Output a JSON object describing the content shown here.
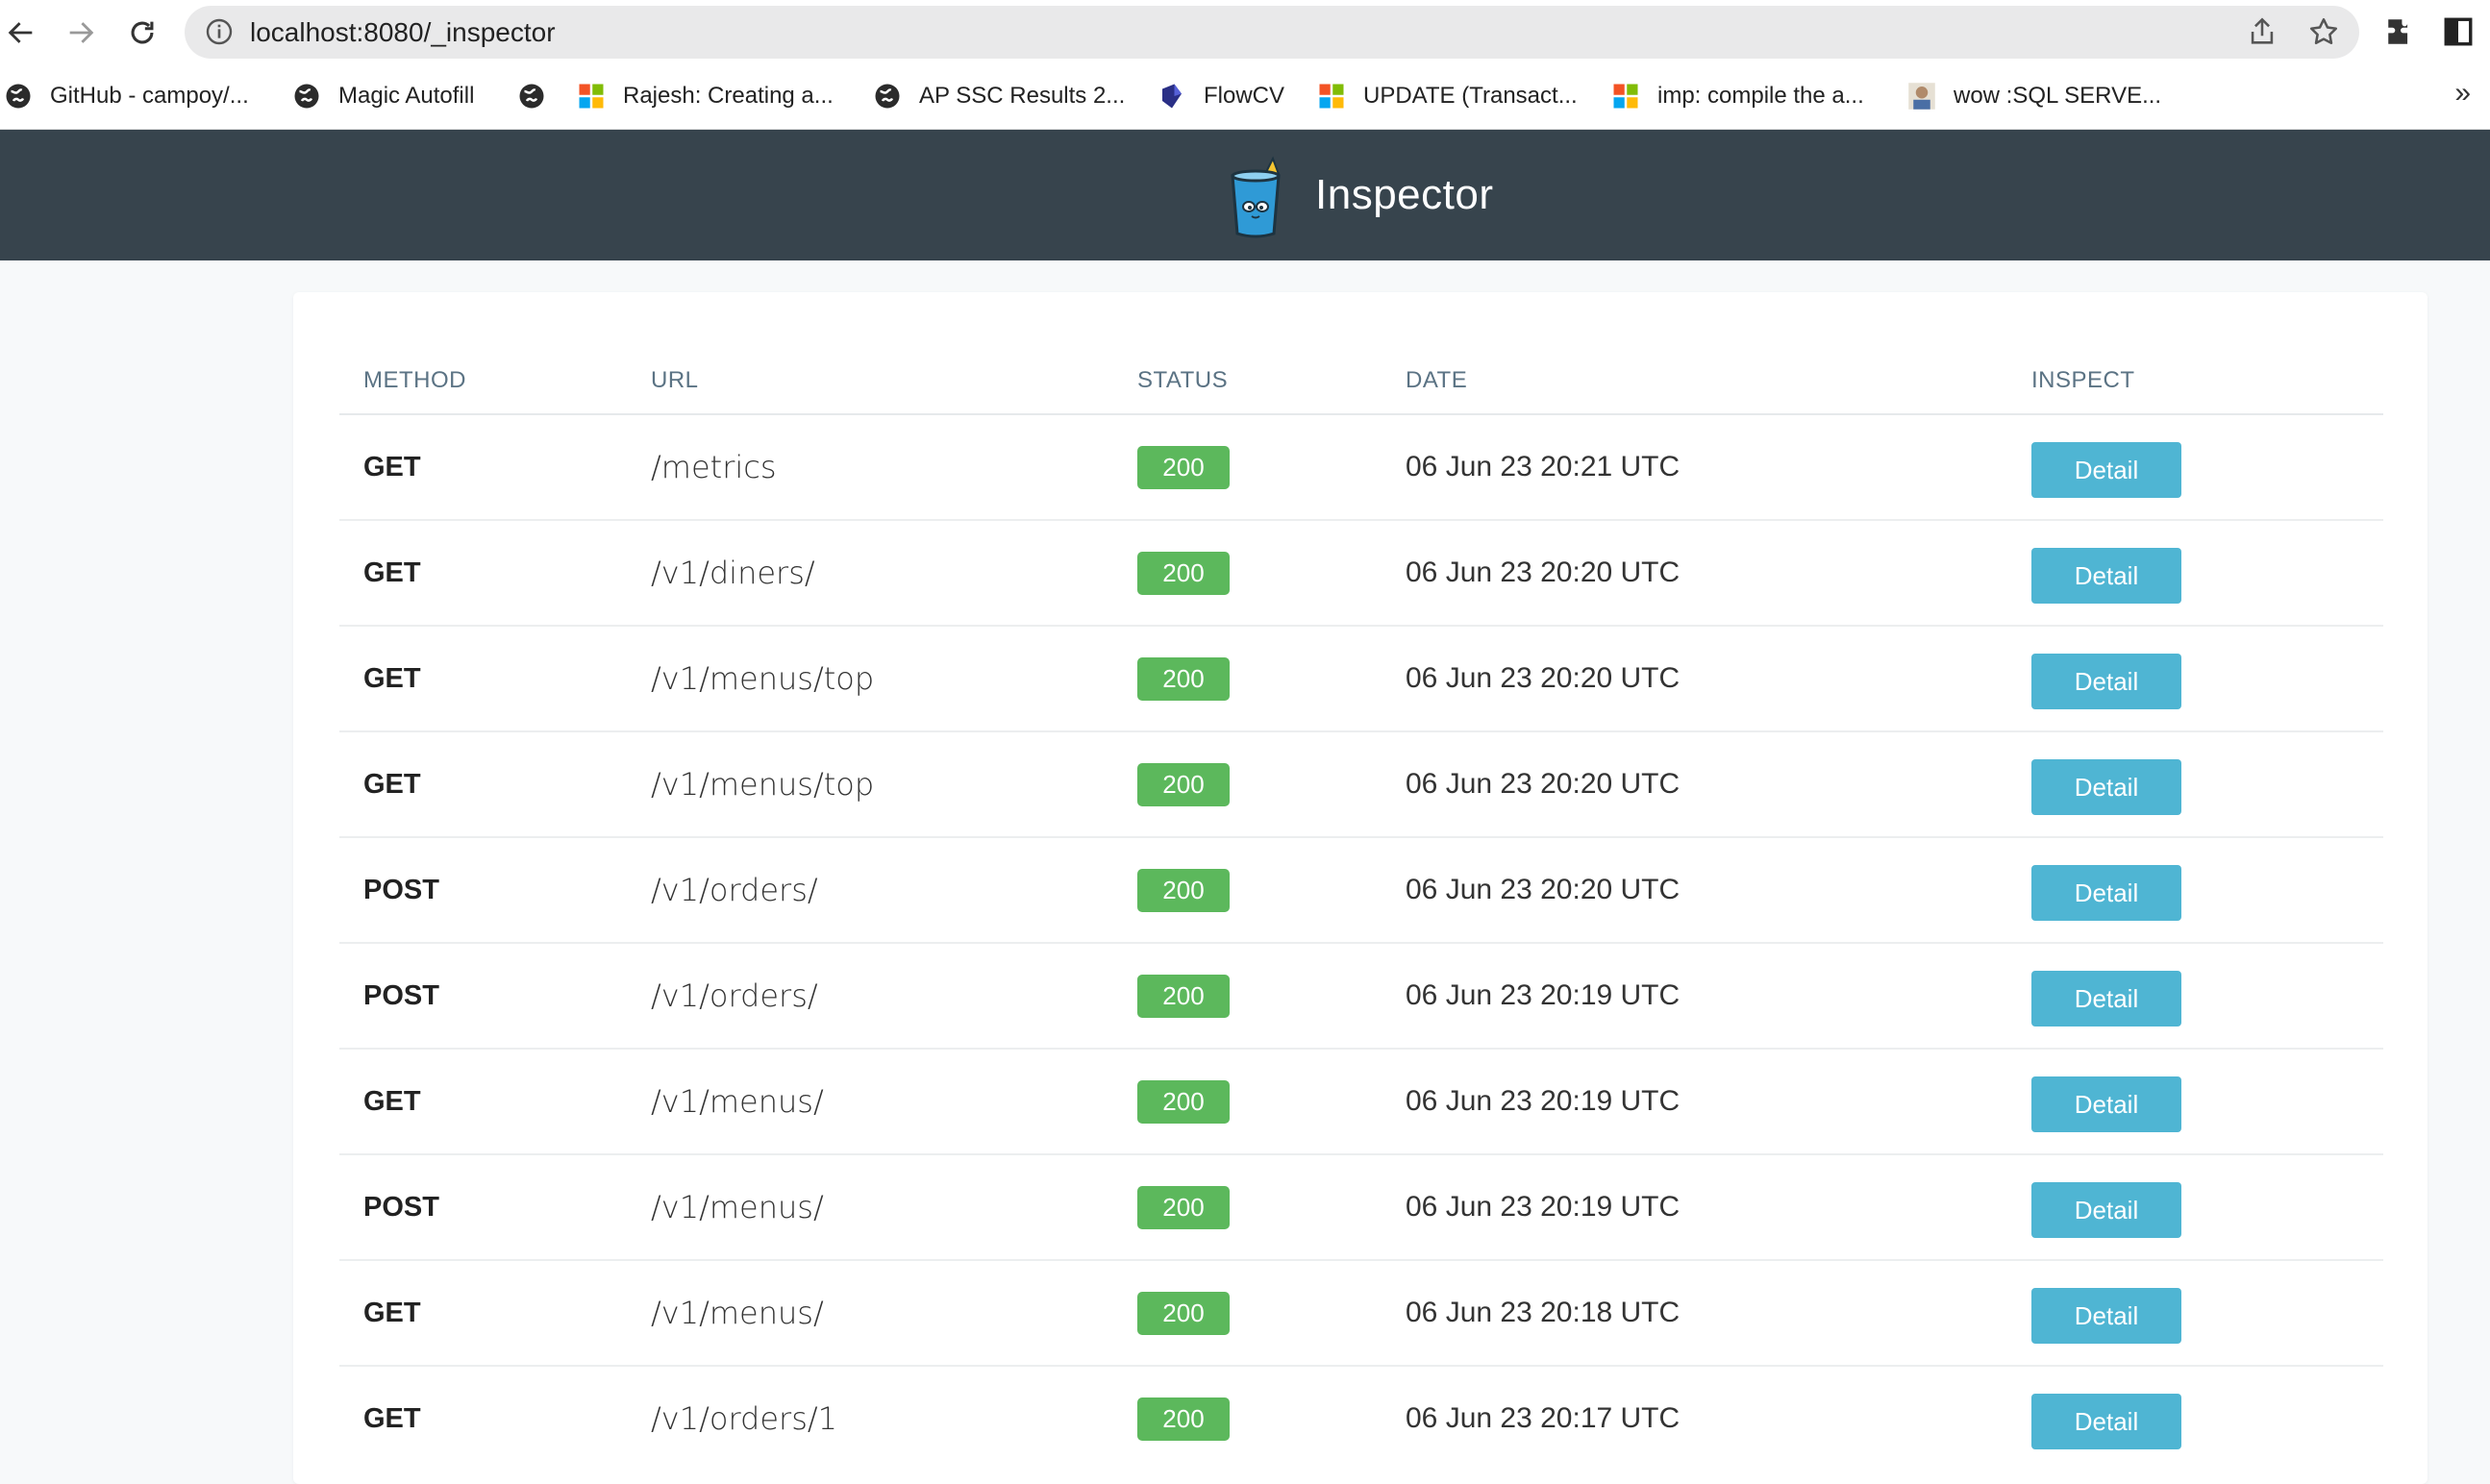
{
  "browser": {
    "url": "localhost:8080/_inspector",
    "bookmarks": [
      {
        "label": "GitHub - campoy/...",
        "icon": "globe-icon"
      },
      {
        "label": "Magic Autofill",
        "icon": "globe-icon"
      },
      {
        "label": "",
        "icon": "globe-icon"
      },
      {
        "label": "Rajesh: Creating a...",
        "icon": "microsoft-icon"
      },
      {
        "label": "AP SSC Results 2...",
        "icon": "globe-icon"
      },
      {
        "label": "FlowCV",
        "icon": "flowcv-icon"
      },
      {
        "label": "UPDATE (Transact...",
        "icon": "microsoft-icon"
      },
      {
        "label": "imp: compile the a...",
        "icon": "microsoft-icon"
      },
      {
        "label": "wow :SQL SERVE...",
        "icon": "avatar-icon"
      }
    ],
    "more_label": "»"
  },
  "app": {
    "title": "Inspector"
  },
  "table": {
    "headers": {
      "method": "METHOD",
      "url": "URL",
      "status": "STATUS",
      "date": "DATE",
      "inspect": "INSPECT"
    },
    "rows": [
      {
        "method": "GET",
        "url": "/metrics",
        "status": "200",
        "date": "06 Jun 23 20:21 UTC",
        "action": "Detail"
      },
      {
        "method": "GET",
        "url": "/v1/diners/",
        "status": "200",
        "date": "06 Jun 23 20:20 UTC",
        "action": "Detail"
      },
      {
        "method": "GET",
        "url": "/v1/menus/top",
        "status": "200",
        "date": "06 Jun 23 20:20 UTC",
        "action": "Detail"
      },
      {
        "method": "GET",
        "url": "/v1/menus/top",
        "status": "200",
        "date": "06 Jun 23 20:20 UTC",
        "action": "Detail"
      },
      {
        "method": "POST",
        "url": "/v1/orders/",
        "status": "200",
        "date": "06 Jun 23 20:20 UTC",
        "action": "Detail"
      },
      {
        "method": "POST",
        "url": "/v1/orders/",
        "status": "200",
        "date": "06 Jun 23 20:19 UTC",
        "action": "Detail"
      },
      {
        "method": "GET",
        "url": "/v1/menus/",
        "status": "200",
        "date": "06 Jun 23 20:19 UTC",
        "action": "Detail"
      },
      {
        "method": "POST",
        "url": "/v1/menus/",
        "status": "200",
        "date": "06 Jun 23 20:19 UTC",
        "action": "Detail"
      },
      {
        "method": "GET",
        "url": "/v1/menus/",
        "status": "200",
        "date": "06 Jun 23 20:18 UTC",
        "action": "Detail"
      },
      {
        "method": "GET",
        "url": "/v1/orders/1",
        "status": "200",
        "date": "06 Jun 23 20:17 UTC",
        "action": "Detail"
      }
    ]
  },
  "colors": {
    "header_bg": "#37444d",
    "status_ok": "#5cb85c",
    "detail_button": "#4fb5d3",
    "column_header": "#5b7384"
  }
}
